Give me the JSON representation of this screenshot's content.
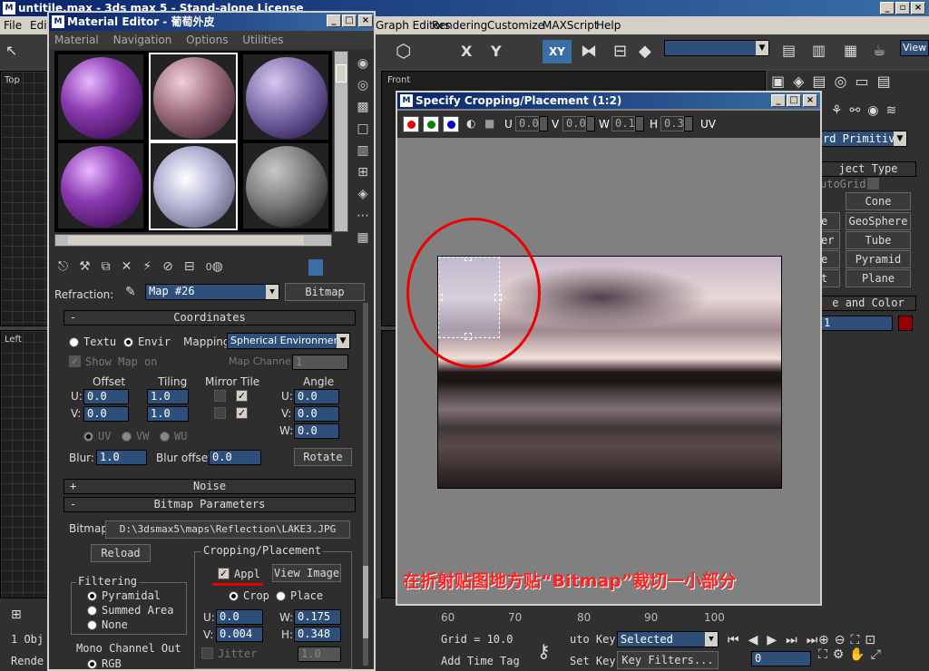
{
  "app": {
    "title": "untitile.max - 3ds max 5 - Stand-alone License"
  },
  "main_menu": [
    "File",
    "Edit",
    "Graph Editors",
    "Rendering",
    "Customize",
    "MAXScript",
    "Help"
  ],
  "toolbar": {
    "axis_x": "X",
    "axis_y": "Y",
    "axis_xy": "XY",
    "view_label": "View"
  },
  "viewports": {
    "top": "Top",
    "left": "Left",
    "front": "Front"
  },
  "material_editor": {
    "title": "Material Editor - 葡萄外皮",
    "menu": [
      "Material",
      "Navigation",
      "Options",
      "Utilities"
    ],
    "refraction_label": "Refraction:",
    "map_name": "Map #26",
    "map_type": "Bitmap",
    "sample_counter": "0",
    "coordinates": {
      "header": "Coordinates",
      "texture_label": "Textu",
      "environ_label": "Envir",
      "mapping_label": "Mapping:",
      "mapping_value": "Spherical Environment",
      "show_map_label": "Show Map on",
      "map_channel_label": "Map Channel:",
      "map_channel_value": "1",
      "offset_label": "Offset",
      "tiling_label": "Tiling",
      "mirror_tile_label": "Mirror Tile",
      "angle_label": "Angle",
      "u_label": "U:",
      "v_label": "V:",
      "w_label": "W:",
      "offset_u": "0.0",
      "offset_v": "0.0",
      "tiling_u": "1.0",
      "tiling_v": "1.0",
      "angle_u": "0.0",
      "angle_v": "0.0",
      "angle_w": "0.0",
      "uv_label": "UV",
      "vw_label": "VW",
      "wu_label": "WU",
      "blur_label": "Blur:",
      "blur_value": "1.0",
      "blur_offset_label": "Blur offset:",
      "blur_offset_value": "0.0",
      "rotate_label": "Rotate"
    },
    "noise_header": "Noise",
    "bitmap_params": {
      "header": "Bitmap Parameters",
      "bitmap_label": "Bitmap:",
      "bitmap_path": "D:\\3dsmax5\\maps\\Reflection\\LAKE3.JPG",
      "reload_label": "Reload",
      "cropping_label": "Cropping/Placement",
      "apply_label": "Appl",
      "view_image_label": "View Image",
      "crop_label": "Crop",
      "place_label": "Place",
      "u_value": "0.0",
      "v_value": "0.004",
      "w_value": "0.175",
      "h_value": "0.348",
      "jitter_label": "Jitter",
      "jitter_value": "1.0",
      "filtering_label": "Filtering",
      "pyramidal_label": "Pyramidal",
      "summed_label": "Summed Area",
      "none_label": "None",
      "mono_label": "Mono Channel Out",
      "rgb_label": "RGB"
    }
  },
  "crop_dialog": {
    "title": "Specify Cropping/Placement (1:2)",
    "u_label": "U",
    "u_value": "0.0",
    "v_label": "V",
    "v_value": "0.0",
    "w_label": "W",
    "w_value": "0.1",
    "h_label": "H",
    "h_value": "0.3",
    "uv_label": "UV",
    "annotation": "在折射贴图地方贴“Bitmap”裁切一小部分"
  },
  "command_panel": {
    "dropdown_value": "rd Primitiv",
    "object_type_label": "ject Type",
    "autogrid_label": "utoGrid",
    "buttons": [
      "Cone",
      "GeoSphere",
      "Tube",
      "Pyramid",
      "Plane"
    ],
    "partial_buttons": [
      "e",
      "er",
      "e",
      "t"
    ],
    "name_color_label": "e and Color",
    "name_value": "1",
    "color": "#9a0000"
  },
  "bottom": {
    "ruler": [
      "60",
      "70",
      "80",
      "90",
      "100"
    ],
    "grid_label": "Grid = 10.0",
    "add_time_tag": "Add Time Tag",
    "auto_key": "uto Key",
    "set_key": "Set Key",
    "selected": "Selected",
    "key_filters": "Key Filters...",
    "frame_value": "0",
    "left_items": [
      "1 Obj",
      "Rende"
    ]
  }
}
